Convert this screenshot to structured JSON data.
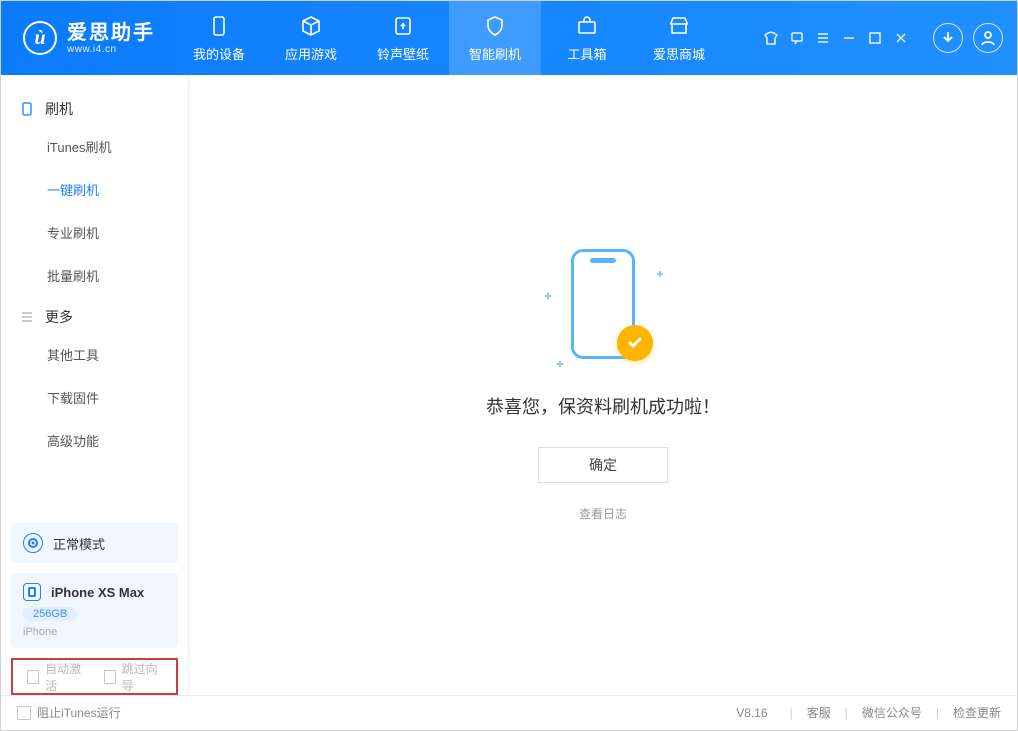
{
  "logo": {
    "title": "爱思助手",
    "subtitle": "www.i4.cn"
  },
  "nav": {
    "tabs": [
      {
        "label": "我的设备"
      },
      {
        "label": "应用游戏"
      },
      {
        "label": "铃声壁纸"
      },
      {
        "label": "智能刷机"
      },
      {
        "label": "工具箱"
      },
      {
        "label": "爱思商城"
      }
    ]
  },
  "sidebar": {
    "groups": [
      {
        "label": "刷机",
        "items": [
          {
            "label": "iTunes刷机"
          },
          {
            "label": "一键刷机",
            "active": true
          },
          {
            "label": "专业刷机"
          },
          {
            "label": "批量刷机"
          }
        ]
      },
      {
        "label": "更多",
        "items": [
          {
            "label": "其他工具"
          },
          {
            "label": "下载固件"
          },
          {
            "label": "高级功能"
          }
        ]
      }
    ],
    "mode_label": "正常模式",
    "device": {
      "name": "iPhone XS Max",
      "storage": "256GB",
      "type": "iPhone"
    }
  },
  "main": {
    "success_text": "恭喜您，保资料刷机成功啦！",
    "ok_button": "确定",
    "log_link": "查看日志"
  },
  "options": {
    "auto_activate": "自动激活",
    "skip_guide": "跳过向导"
  },
  "statusbar": {
    "block_itunes": "阻止iTunes运行",
    "version": "V8.16",
    "links": [
      "客服",
      "微信公众号",
      "检查更新"
    ]
  }
}
